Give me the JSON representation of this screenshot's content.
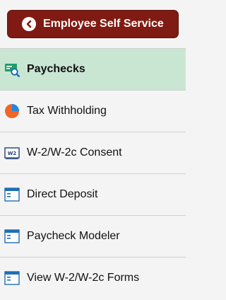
{
  "header": {
    "back_label": "Employee Self Service"
  },
  "nav": {
    "items": [
      {
        "label": "Paychecks",
        "icon": "paycheck-icon",
        "active": true
      },
      {
        "label": "Tax Withholding",
        "icon": "pie-chart-icon",
        "active": false
      },
      {
        "label": "W-2/W-2c Consent",
        "icon": "w2-form-icon",
        "active": false
      },
      {
        "label": "Direct Deposit",
        "icon": "window-icon",
        "active": false
      },
      {
        "label": "Paycheck Modeler",
        "icon": "window-icon",
        "active": false
      },
      {
        "label": "View W-2/W-2c Forms",
        "icon": "window-icon",
        "active": false
      }
    ]
  },
  "colors": {
    "header_button": "#7f1b12",
    "active_row": "#c9e6d3",
    "background": "#f4f4f4",
    "pie_orange": "#f26522",
    "pie_blue": "#1e88e5",
    "icon_blue": "#1e6fb5"
  }
}
